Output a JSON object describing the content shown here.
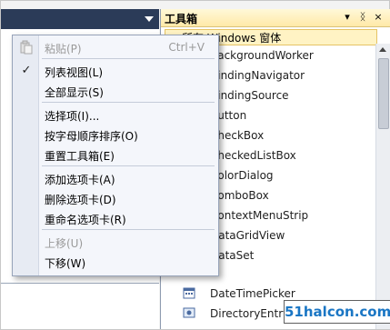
{
  "toolbox": {
    "title": "工具箱",
    "title_buttons": [
      "▾",
      "ᛝ",
      "×"
    ],
    "group_label": "所有 Windows 窗体",
    "items": [
      {
        "label": "BackgroundWorker",
        "icon": "component-icon"
      },
      {
        "label": "BindingNavigator",
        "icon": "navigator-icon"
      },
      {
        "label": "BindingSource",
        "icon": "datasource-icon"
      },
      {
        "label": "Button",
        "icon": "button-icon"
      },
      {
        "label": "CheckBox",
        "icon": "checkbox-icon"
      },
      {
        "label": "CheckedListBox",
        "icon": "checked-list-icon"
      },
      {
        "label": "ColorDialog",
        "icon": "color-dialog-icon"
      },
      {
        "label": "ComboBox",
        "icon": "combobox-icon"
      },
      {
        "label": "ContextMenuStrip",
        "icon": "context-menu-icon"
      },
      {
        "label": "DataGridView",
        "icon": "datagrid-icon"
      },
      {
        "label": "DataSet",
        "icon": "dataset-icon"
      },
      {
        "label": "DateTimePicker",
        "icon": "datetimepicker-icon"
      },
      {
        "label": "DirectoryEntry",
        "icon": "directory-icon"
      }
    ]
  },
  "menu": {
    "items": [
      {
        "label": "粘贴(P)",
        "shortcut": "Ctrl+V",
        "disabled": true,
        "icon": "paste-icon"
      },
      {
        "label": "列表视图(L)",
        "checked": true
      },
      {
        "label": "全部显示(S)"
      },
      {
        "label": "选择项(I)..."
      },
      {
        "label": "按字母顺序排序(O)"
      },
      {
        "label": "重置工具箱(E)"
      },
      {
        "label": "添加选项卡(A)"
      },
      {
        "label": "删除选项卡(D)"
      },
      {
        "label": "重命名选项卡(R)"
      },
      {
        "label": "上移(U)",
        "disabled": true
      },
      {
        "label": "下移(W)"
      }
    ]
  },
  "watermark": {
    "text": "51halcon.com"
  },
  "colors": {
    "accent": "#ffe9a8",
    "menu_bg": "#f4f6fb",
    "doc_strip": "#2b3b58",
    "watermark_text": "#1a76c4"
  }
}
